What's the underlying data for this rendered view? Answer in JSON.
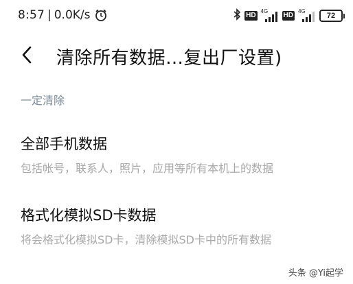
{
  "status_bar": {
    "time": "8:57",
    "separator": "|",
    "net_speed": "0.0K/s",
    "hd_badge_1": "HD",
    "net_gen_1": "4G",
    "hd_badge_2": "HD",
    "net_gen_2": "4G",
    "battery": "72",
    "icons": [
      "alarm-icon",
      "bluetooth-icon",
      "signal-icon",
      "battery-icon"
    ]
  },
  "header": {
    "back_icon": "chevron-left-icon",
    "title": "清除所有数据…复出厂设置)"
  },
  "section": {
    "header": "一定清除"
  },
  "items": [
    {
      "title": "全部手机数据",
      "subtitle": "包括帐号，联系人，照片，应用等所有本机上的数据"
    },
    {
      "title": "格式化模拟SD卡数据",
      "subtitle": "将会格式化模拟SD卡，清除模拟SD卡中的所有数据"
    }
  ],
  "watermark": "头条 @Yi起学"
}
